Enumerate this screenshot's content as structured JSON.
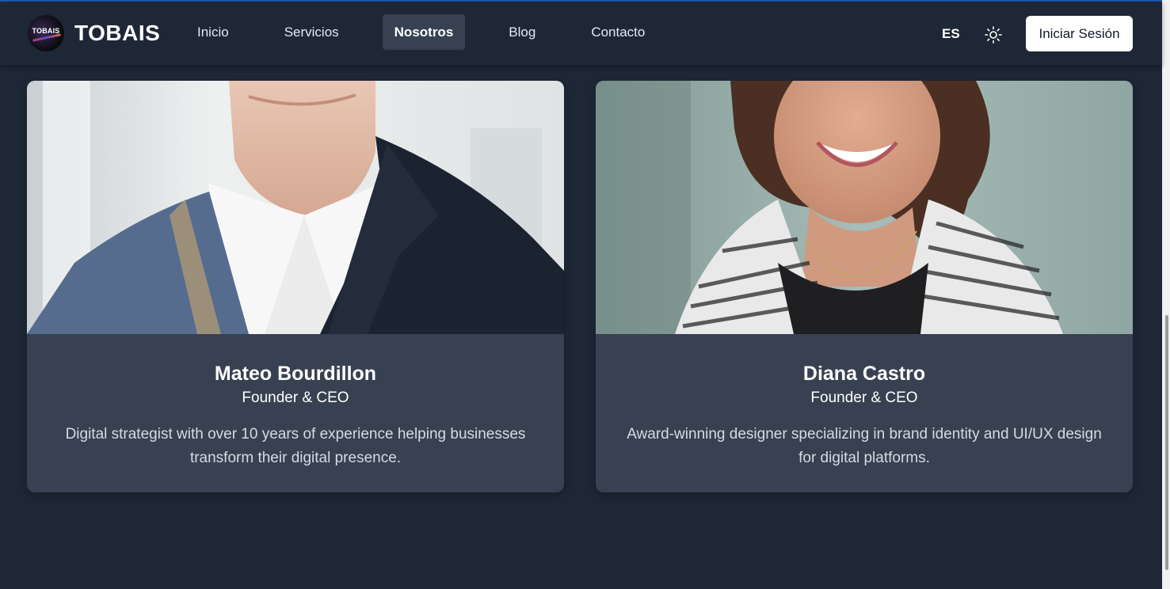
{
  "brand": {
    "name": "TOBAIS",
    "logo_text": "TOBAIS"
  },
  "nav": {
    "items": [
      {
        "label": "Inicio",
        "active": false
      },
      {
        "label": "Servicios",
        "active": false
      },
      {
        "label": "Nosotros",
        "active": true
      },
      {
        "label": "Blog",
        "active": false
      },
      {
        "label": "Contacto",
        "active": false
      }
    ]
  },
  "header": {
    "language": "ES",
    "theme_icon": "sun-icon",
    "login_label": "Iniciar Sesión"
  },
  "team": [
    {
      "name": "Mateo Bourdillon",
      "role": "Founder & CEO",
      "bio": "Digital strategist with over 10 years of experience helping businesses transform their digital presence."
    },
    {
      "name": "Diana Castro",
      "role": "Founder & CEO",
      "bio": "Award-winning designer specializing in brand identity and UI/UX design for digital platforms."
    }
  ],
  "colors": {
    "page_bg": "#1e2736",
    "card_bg": "#374151",
    "active_nav_bg": "#374151",
    "accent_line": "#1e5bb8"
  }
}
